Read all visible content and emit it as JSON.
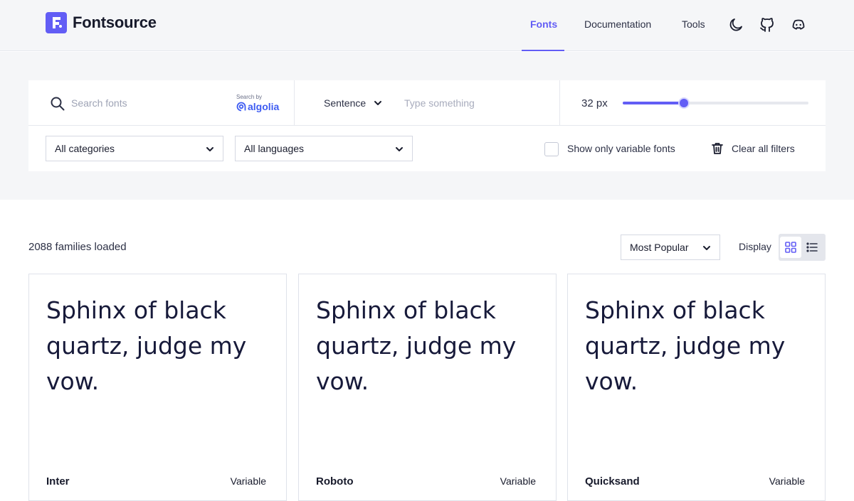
{
  "header": {
    "logo_text": "Fontsource",
    "nav": [
      {
        "label": "Fonts",
        "active": true
      },
      {
        "label": "Documentation",
        "active": false
      },
      {
        "label": "Tools",
        "active": false
      }
    ],
    "icons": [
      "moon-icon",
      "github-icon",
      "discord-icon"
    ]
  },
  "filters": {
    "search": {
      "placeholder": "Search fonts",
      "value": ""
    },
    "algolia": {
      "small": "Search by",
      "brand": "algolia"
    },
    "preview_mode": "Sentence",
    "preview_input": {
      "placeholder": "Type something",
      "value": ""
    },
    "size_label": "32 px",
    "size_slider_fraction": 0.33,
    "category_select": "All categories",
    "language_select": "All languages",
    "variable_checkbox": {
      "label": "Show only variable fonts",
      "checked": false
    },
    "clear_label": "Clear all filters"
  },
  "results": {
    "count_text": "2088 families loaded",
    "sort": "Most Popular",
    "display_label": "Display",
    "display_mode": "grid"
  },
  "cards": [
    {
      "preview": "Sphinx of black quartz, judge my vow.",
      "name": "Inter",
      "variable": "Variable"
    },
    {
      "preview": "Sphinx of black quartz, judge my vow.",
      "name": "Roboto",
      "variable": "Variable"
    },
    {
      "preview": "Sphinx of black quartz, judge my vow.",
      "name": "Quicksand",
      "variable": "Variable"
    }
  ],
  "colors": {
    "accent": "#625df5",
    "background": "#f5f6f8",
    "text": "#1a1d2e"
  }
}
